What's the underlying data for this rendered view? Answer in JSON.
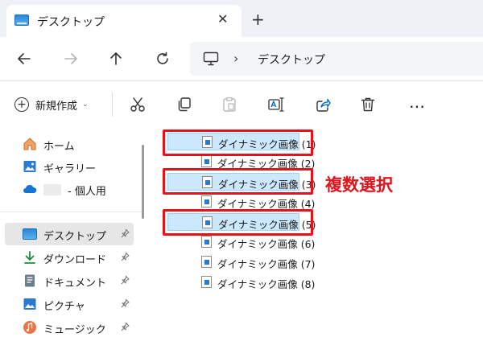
{
  "tab": {
    "title": "デスクトップ",
    "close_glyph": "✕",
    "new_tab_glyph": "+"
  },
  "nav": {
    "back_icon": "arrow-left-icon",
    "forward_icon": "arrow-right-icon",
    "up_icon": "arrow-up-icon",
    "refresh_icon": "refresh-icon",
    "address": {
      "separator": "›",
      "location": "デスクトップ"
    }
  },
  "command_bar": {
    "new_label": "新規作成",
    "new_caret": "⌄",
    "icons": [
      "cut-icon",
      "copy-icon",
      "paste-icon",
      "rename-icon",
      "share-icon",
      "delete-icon"
    ],
    "more_label": "…"
  },
  "sidebar": {
    "items": [
      {
        "label": "ホーム",
        "icon": "home-icon",
        "pinned": false
      },
      {
        "label": "ギャラリー",
        "icon": "gallery-icon",
        "pinned": false
      },
      {
        "label": "- 個人用",
        "icon": "onedrive-icon",
        "pinned": false
      },
      {
        "label": "デスクトップ",
        "icon": "desktop-icon",
        "pinned": true,
        "active": true
      },
      {
        "label": "ダウンロード",
        "icon": "download-icon",
        "pinned": true
      },
      {
        "label": "ドキュメント",
        "icon": "documents-icon",
        "pinned": true
      },
      {
        "label": "ピクチャ",
        "icon": "pictures-icon",
        "pinned": true
      },
      {
        "label": "ミュージック",
        "icon": "music-icon",
        "pinned": true
      }
    ]
  },
  "files": [
    {
      "name": "ダイナミック画像 (1)",
      "selected": true
    },
    {
      "name": "ダイナミック画像 (2)",
      "selected": false
    },
    {
      "name": "ダイナミック画像 (3)",
      "selected": true
    },
    {
      "name": "ダイナミック画像 (4)",
      "selected": false
    },
    {
      "name": "ダイナミック画像 (5)",
      "selected": true
    },
    {
      "name": "ダイナミック画像 (6)",
      "selected": false
    },
    {
      "name": "ダイナミック画像 (7)",
      "selected": false
    },
    {
      "name": "ダイナミック画像 (8)",
      "selected": false
    }
  ],
  "annotation": {
    "callout_text": "複数選択",
    "color": "#e3131b"
  },
  "colors": {
    "selection": "#cce8ff",
    "accent": "#0067c0"
  }
}
